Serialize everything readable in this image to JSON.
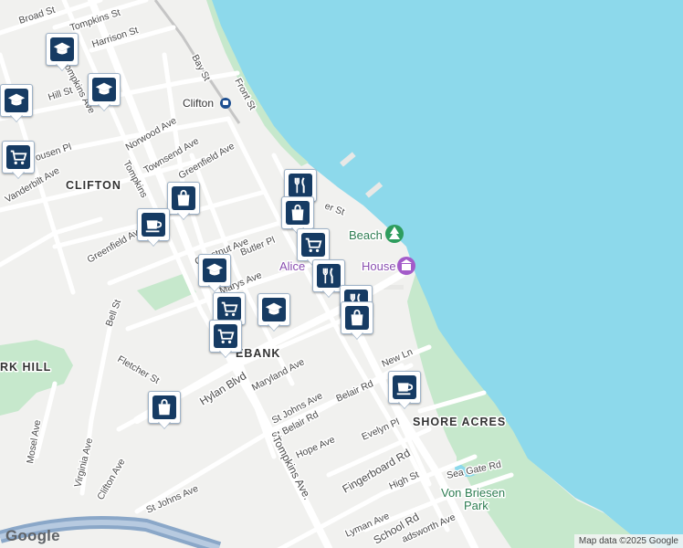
{
  "map": {
    "water_color": "#8dd9eb",
    "land_color": "#f1f1ef",
    "park_color": "#c6e8cc",
    "marker_color": "#163b63"
  },
  "neighborhoods": {
    "clifton": "CLIFTON",
    "rosebank": "EBANK",
    "shore_acres": "SHORE ACRES",
    "grymes_hill": "RK HILL"
  },
  "places": {
    "clifton_station": "Clifton",
    "beach": "Beach",
    "alice_house_a": "Alice",
    "alice_house_b": "House",
    "von_briesen_1": "Von Briesen",
    "von_briesen_2": "Park"
  },
  "streets": {
    "broad_st": "Broad St",
    "tompkins_st": "Tompkins St",
    "harrison_st": "Harrison St",
    "bay_st": "Bay St",
    "front_st": "Front St",
    "hill_st": "Hill St",
    "vanbuskirk": "Tompkins Ave",
    "norwood_ave": "Norwood Ave",
    "townsend_ave": "Townsend Ave",
    "greenfield_ave_n": "Greenfield Ave",
    "bousen_pl": "ousen Pl",
    "vanderbilt_ave": "Vanderbilt Ave",
    "tompkins_ave_n": "Tompkins",
    "greenfield_ave_s": "Greenfield Ave",
    "chestnut_ave": "Chestnut Ave",
    "butler_pl": "Butler Pl",
    "marys_ave": "Marys Ave",
    "water_st": "er St",
    "bell_st": "Bell St",
    "fletcher_st": "Fletcher St",
    "hylan_blvd": "Hylan Blvd",
    "maryland_ave": "Maryland Ave",
    "new_ln": "New Ln",
    "st_johns_ave_n": "St Johns Ave",
    "belair_rd_n": "Belair Rd",
    "belair_rd_s": "St Belair Rd",
    "mosel_ave": "Mosel Ave",
    "virginia_ave": "Virginia Ave",
    "clifton_ave": "Clifton Ave",
    "hope_ave": "Hope Ave",
    "evelyn_pl": "Evelyn Pl",
    "fingerboard_rd": "Fingerboard Rd",
    "high_st": "High St",
    "sea_gate_rd": "Sea Gate Rd",
    "tompkins_ave_s": "Tompkins Ave.",
    "st_johns_ave_s": "St Johns Ave",
    "lyman_ave": "Lyman Ave",
    "school_rd": "School Rd",
    "wadsworth_ave": "adsworth Ave"
  },
  "markers": [
    {
      "type": "school",
      "icon": "graduation-cap-icon"
    },
    {
      "type": "school",
      "icon": "graduation-cap-icon"
    },
    {
      "type": "school",
      "icon": "graduation-cap-icon"
    },
    {
      "type": "school",
      "icon": "graduation-cap-icon"
    },
    {
      "type": "school",
      "icon": "graduation-cap-icon"
    },
    {
      "type": "grocery",
      "icon": "shopping-cart-icon"
    },
    {
      "type": "shopping",
      "icon": "shopping-bag-icon"
    },
    {
      "type": "cafe",
      "icon": "coffee-cup-icon"
    },
    {
      "type": "restaurant",
      "icon": "fork-knife-icon"
    },
    {
      "type": "shopping",
      "icon": "shopping-bag-icon"
    },
    {
      "type": "grocery",
      "icon": "shopping-cart-icon"
    },
    {
      "type": "restaurant",
      "icon": "fork-knife-icon"
    },
    {
      "type": "restaurant",
      "icon": "fork-knife-icon"
    },
    {
      "type": "shopping",
      "icon": "shopping-bag-icon"
    },
    {
      "type": "grocery",
      "icon": "shopping-cart-icon"
    },
    {
      "type": "grocery",
      "icon": "shopping-cart-icon"
    },
    {
      "type": "shopping",
      "icon": "shopping-bag-icon"
    },
    {
      "type": "cafe",
      "icon": "coffee-cup-icon"
    }
  ],
  "footer": {
    "logo": "Google",
    "attribution": "Map data ©2025 Google"
  }
}
